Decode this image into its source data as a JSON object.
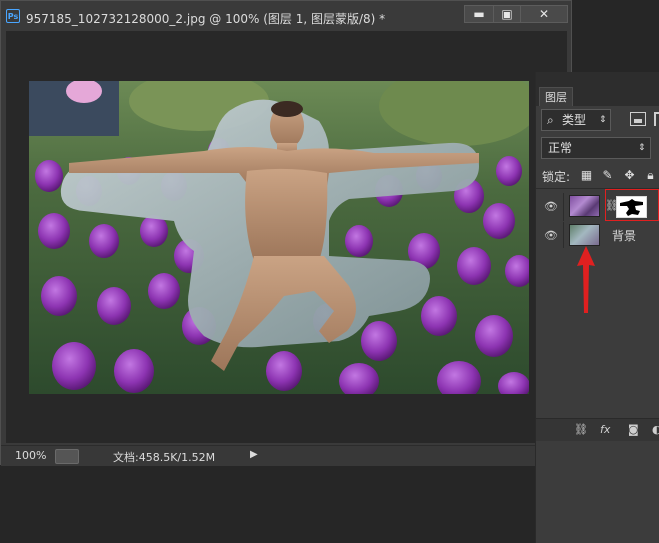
{
  "document": {
    "title": "957185_102732128000_2.jpg @ 100% (图层 1, 图层蒙版/8) *",
    "app_icon": "Ps",
    "window_buttons": {
      "minimize": "▬",
      "maximize": "▣",
      "close": "✕"
    }
  },
  "status": {
    "zoom": "100%",
    "doc_info": "文档:458.5K/1.52M",
    "arrow": "▶"
  },
  "layers_panel": {
    "tab": "图层",
    "filter_kind": "类型",
    "blend_mode": "正常",
    "lock_label": "锁定:",
    "layers": [
      {
        "name": "",
        "has_mask": true,
        "visible_eye": "eye-icon"
      },
      {
        "name": "背景",
        "has_mask": false,
        "visible_eye": "eye-icon"
      }
    ]
  },
  "colors": {
    "annotation_red": "#e02020",
    "panel_bg": "#3c3c3c",
    "app_bg": "#262626"
  }
}
